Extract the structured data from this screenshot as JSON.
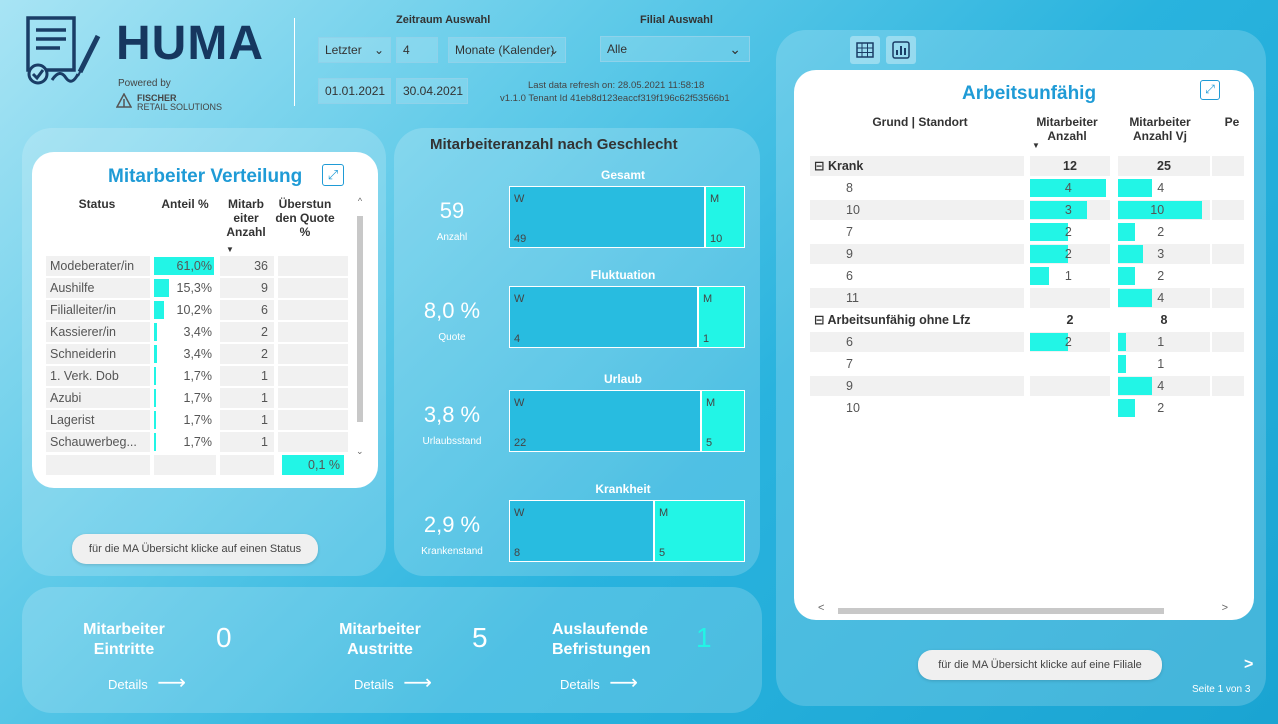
{
  "header": {
    "brand": "HUMA",
    "powered": "Powered by",
    "company_line1": "FISCHER",
    "company_line2": "RETAIL SOLUTIONS",
    "zeitraum_label": "Zeitraum Auswahl",
    "filial_label": "Filial Auswahl",
    "period_mode": "Letzter",
    "period_count": "4",
    "period_unit": "Monate (Kalender)",
    "filial_value": "Alle",
    "date_from": "01.01.2021",
    "date_to": "30.04.2021",
    "refresh_line1": "Last data refresh on: 28.05.2021 11:58:18",
    "refresh_line2": "v1.1.0 Tenant Id 41eb8d123eaccf319f196c62f53566b1"
  },
  "verteilung": {
    "title": "Mitarbeiter Verteilung",
    "col_status": "Status",
    "col_anteil": "Anteil %",
    "col_anzahl": "Mitarb eiter Anzahl",
    "col_ueber": "Überstun den Quote %",
    "rows": [
      {
        "status": "Modeberater/in",
        "anteil": "61,0%",
        "anteil_val": 61.0,
        "anzahl": "36"
      },
      {
        "status": "Aushilfe",
        "anteil": "15,3%",
        "anteil_val": 15.3,
        "anzahl": "9"
      },
      {
        "status": "Filialleiter/in",
        "anteil": "10,2%",
        "anteil_val": 10.2,
        "anzahl": "6"
      },
      {
        "status": "Kassierer/in",
        "anteil": "3,4%",
        "anteil_val": 3.4,
        "anzahl": "2"
      },
      {
        "status": "Schneiderin",
        "anteil": "3,4%",
        "anteil_val": 3.4,
        "anzahl": "2"
      },
      {
        "status": "1. Verk. Dob",
        "anteil": "1,7%",
        "anteil_val": 1.7,
        "anzahl": "1"
      },
      {
        "status": "Azubi",
        "anteil": "1,7%",
        "anteil_val": 1.7,
        "anzahl": "1"
      },
      {
        "status": "Lagerist",
        "anteil": "1,7%",
        "anteil_val": 1.7,
        "anzahl": "1"
      },
      {
        "status": "Schauwerbeg...",
        "anteil": "1,7%",
        "anteil_val": 1.7,
        "anzahl": "1"
      }
    ],
    "total_ueber": "0,1 %",
    "button": "für die MA Übersicht klicke auf einen Status"
  },
  "geschlecht": {
    "title": "Mitarbeiteranzahl nach Geschlecht",
    "blocks": [
      {
        "name": "Gesamt",
        "big": "59",
        "sub": "Anzahl",
        "w": 49,
        "m": 10
      },
      {
        "name": "Fluktuation",
        "big": "8,0 %",
        "sub": "Quote",
        "w": 4,
        "m": 1
      },
      {
        "name": "Urlaub",
        "big": "3,8 %",
        "sub": "Urlaubsstand",
        "w": 22,
        "m": 5
      },
      {
        "name": "Krankheit",
        "big": "2,9 %",
        "sub": "Krankenstand",
        "w": 8,
        "m": 5
      }
    ],
    "w_label": "W",
    "m_label": "M"
  },
  "bottom": {
    "eintritte_label": "Mitarbeiter Eintritte",
    "eintritte": "0",
    "austritte_label": "Mitarbeiter Austritte",
    "austritte": "5",
    "befristung_label": "Auslaufende Befristungen",
    "befristung": "1",
    "details": "Details"
  },
  "arbeitsunfaehig": {
    "title": "Arbeitsunfähig",
    "col_grund": "Grund | Standort",
    "col_anzahl": "Mitarbeiter Anzahl",
    "col_vj": "Mitarbeiter Anzahl Vj",
    "col_more": "Pe",
    "rows": [
      {
        "label": "Krank",
        "group": true,
        "a": "12",
        "vj": "25"
      },
      {
        "label": "8",
        "a": "4",
        "vj": "4",
        "av": 4,
        "vv": 4
      },
      {
        "label": "10",
        "a": "3",
        "vj": "10",
        "av": 3,
        "vv": 10
      },
      {
        "label": "7",
        "a": "2",
        "vj": "2",
        "av": 2,
        "vv": 2
      },
      {
        "label": "9",
        "a": "2",
        "vj": "3",
        "av": 2,
        "vv": 3
      },
      {
        "label": "6",
        "a": "1",
        "vj": "2",
        "av": 1,
        "vv": 2
      },
      {
        "label": "11",
        "a": "",
        "vj": "4",
        "av": 0,
        "vv": 4
      },
      {
        "label": "Arbeitsunfähig ohne Lfz",
        "group": true,
        "a": "2",
        "vj": "8"
      },
      {
        "label": "6",
        "a": "2",
        "vj": "1",
        "av": 2,
        "vv": 1
      },
      {
        "label": "7",
        "a": "",
        "vj": "1",
        "av": 0,
        "vv": 1
      },
      {
        "label": "9",
        "a": "",
        "vj": "4",
        "av": 0,
        "vv": 4
      },
      {
        "label": "10",
        "a": "",
        "vj": "2",
        "av": 0,
        "vv": 2
      }
    ],
    "button": "für die MA Übersicht klicke auf eine Filiale",
    "page": "Seite 1 von 3"
  }
}
